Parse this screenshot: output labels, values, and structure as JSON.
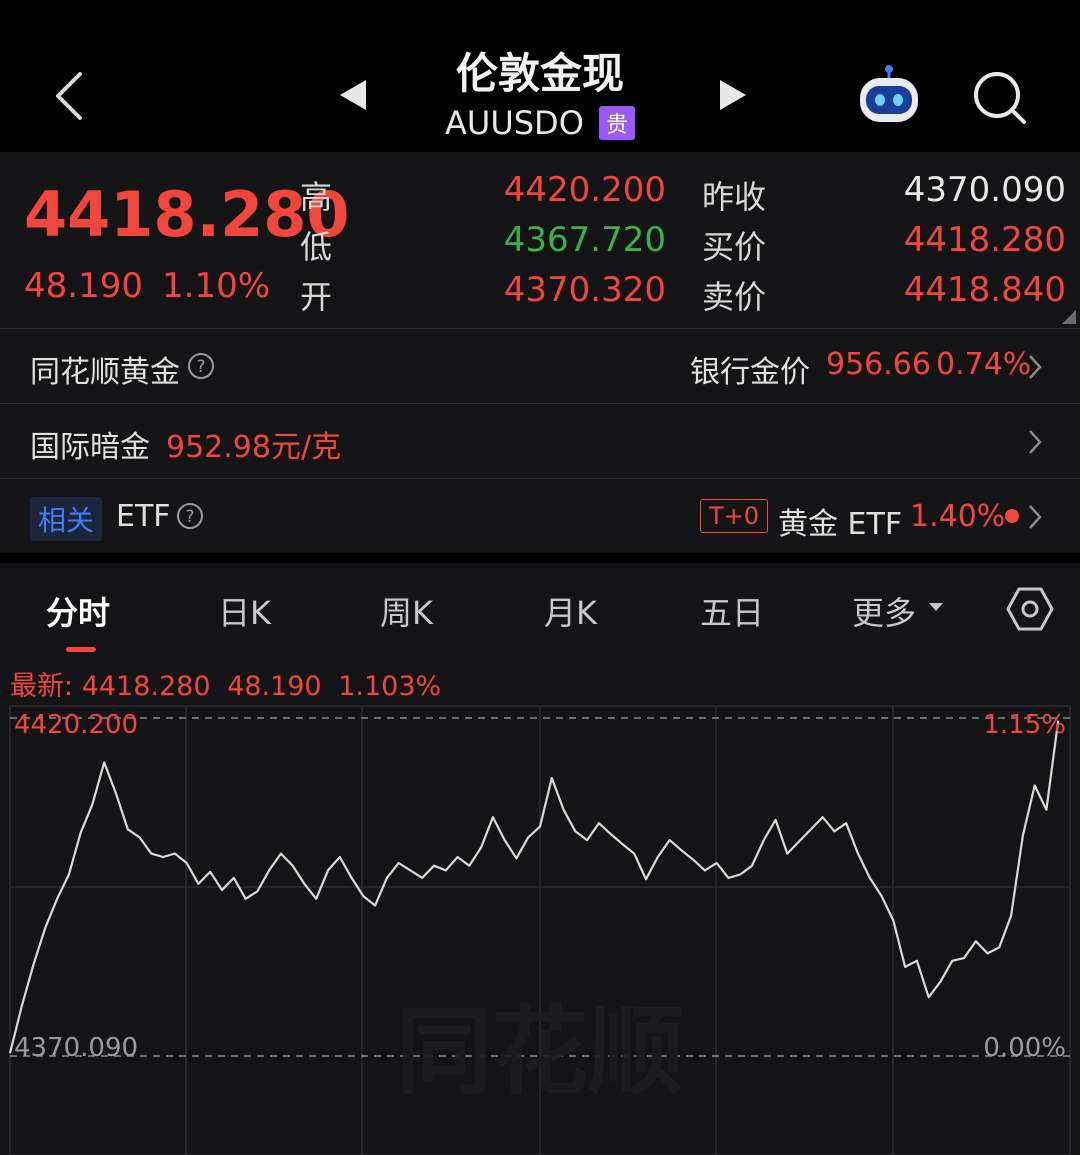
{
  "header": {
    "title": "伦敦金现",
    "symbol": "AUUSDO",
    "badge": "贵"
  },
  "quote": {
    "last": "4418.280",
    "change": "48.190",
    "change_pct": "1.10%",
    "labels": {
      "high": "高",
      "low": "低",
      "open": "开",
      "prev_close": "昨收",
      "bid": "买价",
      "ask": "卖价"
    },
    "high": "4420.200",
    "low": "4367.720",
    "open": "4370.320",
    "prev_close": "4370.090",
    "bid": "4418.280",
    "ask": "4418.840"
  },
  "rows": {
    "ths_gold_label": "同花顺黄金",
    "bank_gold_label": "银行金价",
    "bank_gold_price": "956.66",
    "bank_gold_pct": "0.74%",
    "intl_label": "国际暗金",
    "intl_value": "952.98元/克",
    "related_tag": "相关",
    "etf_label": "ETF",
    "t0_tag": "T+0",
    "gold_etf_label": "黄金 ETF",
    "gold_etf_pct": "1.40%"
  },
  "tabs": [
    "分时",
    "日K",
    "周K",
    "月K",
    "五日",
    "更多"
  ],
  "chart_info": {
    "latest_prefix": "最新:",
    "latest_price": "4418.280",
    "latest_change": "48.190",
    "latest_pct": "1.103%",
    "watermark": "同花顺"
  },
  "colors": {
    "up": "#f0463c",
    "down": "#3cb04a",
    "line": "#d9d9d9",
    "accent": "#9b59f5"
  },
  "chart_data": {
    "type": "line",
    "ylim": [
      4370.09,
      4420.2
    ],
    "y_tick_labels": {
      "top": "4420.200",
      "bottom": "4370.090"
    },
    "right_tick_labels": {
      "top": "1.15%",
      "bottom": "0.00%"
    },
    "x": [
      0,
      2,
      4,
      6,
      8,
      10,
      12,
      14,
      16,
      18,
      20,
      22,
      24,
      26,
      28,
      30,
      32,
      34,
      36,
      38,
      40,
      42,
      44,
      46,
      48,
      50,
      52,
      54,
      56,
      58,
      60,
      62,
      64,
      66,
      68,
      70,
      72,
      74,
      76,
      78,
      80,
      82,
      84,
      86,
      88,
      90,
      92,
      94,
      96,
      98,
      100,
      102,
      104,
      106,
      108,
      110,
      112,
      114,
      116,
      118,
      120,
      122,
      124,
      126,
      128,
      130,
      132,
      134,
      136,
      138,
      140,
      142,
      144,
      146,
      148,
      150,
      152,
      154,
      156,
      158,
      160,
      162,
      164,
      166,
      168,
      170,
      172,
      174,
      176,
      178
    ],
    "values": [
      4370.5,
      4377.5,
      4383.7,
      4389.1,
      4393.4,
      4397.0,
      4403.2,
      4407.4,
      4413.6,
      4409.0,
      4403.7,
      4402.5,
      4400.1,
      4399.6,
      4400.1,
      4398.7,
      4395.6,
      4397.4,
      4394.7,
      4396.5,
      4393.4,
      4394.5,
      4397.6,
      4400.1,
      4398.3,
      4395.6,
      4393.4,
      4397.6,
      4399.6,
      4396.5,
      4393.8,
      4392.4,
      4396.5,
      4398.7,
      4397.6,
      4396.5,
      4398.3,
      4397.6,
      4399.6,
      4398.3,
      4401.0,
      4405.5,
      4402.1,
      4399.4,
      4402.5,
      4404.1,
      4411.3,
      4406.6,
      4403.4,
      4402.1,
      4404.6,
      4403.0,
      4401.5,
      4400.1,
      4396.3,
      4399.6,
      4402.1,
      4400.6,
      4399.2,
      4397.6,
      4398.7,
      4396.5,
      4397.0,
      4398.3,
      4402.1,
      4405.1,
      4400.1,
      4401.9,
      4403.7,
      4405.5,
      4403.4,
      4404.6,
      4400.1,
      4396.5,
      4393.8,
      4390.2,
      4383.3,
      4384.2,
      4378.8,
      4381.1,
      4384.2,
      4384.6,
      4387.1,
      4385.3,
      4386.2,
      4390.9,
      4402.8,
      4410.2,
      4406.6,
      4419.8
    ]
  }
}
